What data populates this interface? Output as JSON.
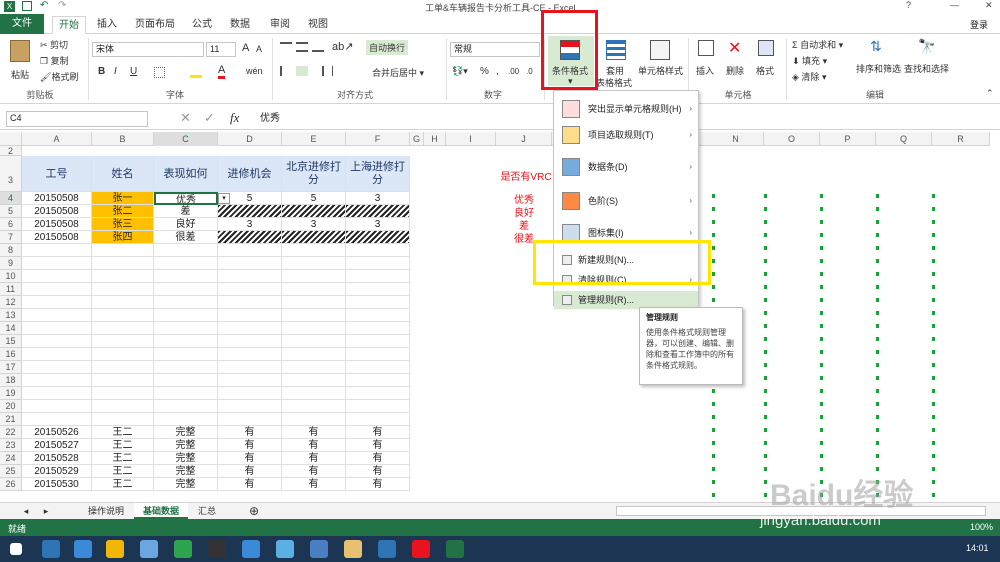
{
  "window": {
    "title": "工单&车辆报告卡分析工具-CE - Excel",
    "login": "登录"
  },
  "tabs": [
    "文件",
    "开始",
    "插入",
    "页面布局",
    "公式",
    "数据",
    "审阅",
    "视图"
  ],
  "ribbon": {
    "clipboard": {
      "paste": "粘贴",
      "cut": "剪切",
      "copy": "复制",
      "format_painter": "格式刷",
      "label": "剪贴板"
    },
    "font": {
      "name": "宋体",
      "size": "11",
      "bold": "B",
      "italic": "I",
      "underline": "U",
      "grow": "A",
      "shrink": "A",
      "wen": "wén",
      "label": "字体"
    },
    "align": {
      "wrap": "自动换行",
      "merge": "合并后居中",
      "label": "对齐方式"
    },
    "number": {
      "format": "常规",
      "percent": "%",
      "comma": ",",
      "inc": ".00",
      "dec": ".0",
      "label": "数字"
    },
    "styles": {
      "cond_format": "条件格式",
      "table_format_1": "套用",
      "table_format_2": "表格格式",
      "cell_style": "单元格样式"
    },
    "cells": {
      "insert": "插入",
      "delete": "删除",
      "format": "格式",
      "label": "单元格"
    },
    "editing": {
      "autosum": "自动求和",
      "fill": "填充",
      "clear": "清除",
      "sort": "排序和筛选",
      "find": "查找和选择",
      "label": "编辑"
    }
  },
  "formula": {
    "name_box": "C4",
    "fx": "fx",
    "content": "优秀"
  },
  "columns": [
    "A",
    "B",
    "C",
    "D",
    "E",
    "F",
    "G",
    "H",
    "I",
    "J",
    "N",
    "O",
    "P",
    "Q",
    "R"
  ],
  "table": {
    "headers": [
      "工号",
      "姓名",
      "表现如何",
      "进修机会",
      "北京进修打分",
      "上海进修打分"
    ],
    "rows": [
      {
        "no": "4",
        "id": "20150508",
        "name": "张一",
        "perf": "优秀",
        "d": "5",
        "e": "5",
        "f": "3"
      },
      {
        "no": "5",
        "id": "20150508",
        "name": "张二",
        "perf": "差",
        "d": "",
        "e": "",
        "f": ""
      },
      {
        "no": "6",
        "id": "20150508",
        "name": "张三",
        "perf": "良好",
        "d": "3",
        "e": "3",
        "f": "3"
      },
      {
        "no": "7",
        "id": "20150508",
        "name": "张四",
        "perf": "很差",
        "d": "",
        "e": "",
        "f": ""
      }
    ],
    "lower_rows": [
      {
        "no": "22",
        "id": "20150526",
        "name": "王二",
        "perf": "完整",
        "d": "有",
        "e": "有",
        "f": "有"
      },
      {
        "no": "23",
        "id": "20150527",
        "name": "王二",
        "perf": "完整",
        "d": "有",
        "e": "有",
        "f": "有"
      },
      {
        "no": "24",
        "id": "20150528",
        "name": "王二",
        "perf": "完整",
        "d": "有",
        "e": "有",
        "f": "有"
      },
      {
        "no": "25",
        "id": "20150529",
        "name": "王二",
        "perf": "完整",
        "d": "有",
        "e": "有",
        "f": "有"
      },
      {
        "no": "26",
        "id": "20150530",
        "name": "王二",
        "perf": "完整",
        "d": "有",
        "e": "有",
        "f": "有"
      }
    ],
    "empty_rows": [
      "8",
      "9",
      "10",
      "11",
      "12",
      "13",
      "14",
      "15",
      "16",
      "17",
      "18",
      "19",
      "20",
      "21"
    ],
    "side_header": "是否有VRC",
    "side_values": [
      "优秀",
      "良好",
      "差",
      "很差"
    ]
  },
  "menu": {
    "items": [
      {
        "label": "突出显示单元格规则(H)",
        "arrow": "›"
      },
      {
        "label": "项目选取规则(T)",
        "arrow": "›"
      },
      {
        "label": "数据条(D)",
        "arrow": "›"
      },
      {
        "label": "色阶(S)",
        "arrow": "›"
      },
      {
        "label": "图标集(I)",
        "arrow": "›"
      },
      {
        "label": "新建规则(N)...",
        "arrow": ""
      },
      {
        "label": "清除规则(C)",
        "arrow": "›"
      },
      {
        "label": "管理规则(R)...",
        "arrow": ""
      }
    ]
  },
  "tooltip": {
    "title": "管理规则",
    "body": "使用条件格式规则管理器，可以创建、编辑、删除和查看工作簿中的所有条件格式规则。"
  },
  "sheets": [
    "操作说明",
    "基础数据",
    "汇总"
  ],
  "status": {
    "ready": "就绪",
    "zoom": "100%"
  },
  "taskbar": {
    "time": "14:01"
  },
  "watermark": {
    "logo": "Baidu经验",
    "url": "jingyan.baidu.com"
  },
  "colors": {
    "excel_green": "#217346",
    "header_blue": "#dbe7f6",
    "name_orange": "#ffc000",
    "red_text": "#e8131d",
    "highlight_red": "#e8131d",
    "highlight_yellow": "#ffe600"
  }
}
